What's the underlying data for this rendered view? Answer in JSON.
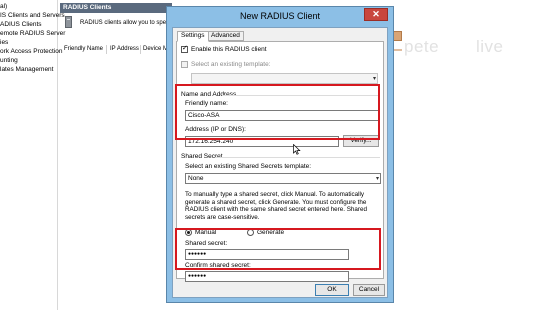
{
  "tree": {
    "items": [
      "al)",
      "IS Clients and Servers",
      "ADIUS Clients",
      "emote RADIUS Server",
      "ies",
      "ork Access Protection",
      "unting",
      "lates Management"
    ]
  },
  "results": {
    "header": "RADIUS Clients",
    "description": "RADIUS clients allow you to specif",
    "columns": [
      "Friendly Name",
      "IP Address",
      "Device M"
    ]
  },
  "background": {
    "brand_left": "pete",
    "brand_right": "live"
  },
  "dialog": {
    "title": "New RADIUS Client",
    "close_label": "✕",
    "tabs": [
      "Settings",
      "Advanced"
    ],
    "enable_client_label": "Enable this RADIUS client",
    "enable_client_checked": true,
    "select_template_label": "Select an existing template:",
    "select_template_checked": false,
    "template_value": "",
    "name_address_label": "Name and Address",
    "friendly_name_label": "Friendly name:",
    "friendly_name_value": "Cisco-ASA",
    "address_label": "Address (IP or DNS):",
    "address_value": "172.16.254.240",
    "verify_label": "Verify...",
    "shared_secret_group_label": "Shared Secret",
    "shared_secret_template_label": "Select an existing Shared Secrets template:",
    "shared_secret_template_value": "None",
    "help_text": "To manually type a shared secret, click Manual. To automatically generate a shared secret, click Generate. You must configure the RADIUS client with the same shared secret entered here. Shared secrets are case-sensitive.",
    "manual_label": "Manual",
    "generate_label": "Generate",
    "manual_selected": true,
    "shared_secret_label": "Shared secret:",
    "shared_secret_value": "●●●●●●",
    "confirm_secret_label": "Confirm shared secret:",
    "confirm_secret_value": "●●●●●●",
    "ok_label": "OK",
    "cancel_label": "Cancel"
  },
  "colors": {
    "highlight": "#d6181f",
    "dialog_frame": "#8cbfe6",
    "close_button": "#c9463d",
    "results_header": "#5a6a7e"
  }
}
